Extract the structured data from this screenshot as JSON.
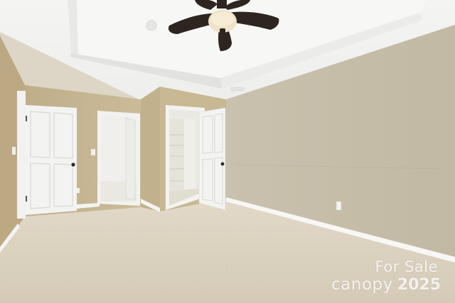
{
  "watermark": {
    "line1": "For Sale",
    "brand": "canopy",
    "year": "2025"
  },
  "colors": {
    "wall_right": "#c7bea9",
    "wall_left": "#c5b48f",
    "ceiling": "#f2f2f0",
    "carpet": "#d9cfbd",
    "door": "#f3f3f2",
    "trim": "#f7f7f5",
    "fan_blade": "#2e2520"
  }
}
